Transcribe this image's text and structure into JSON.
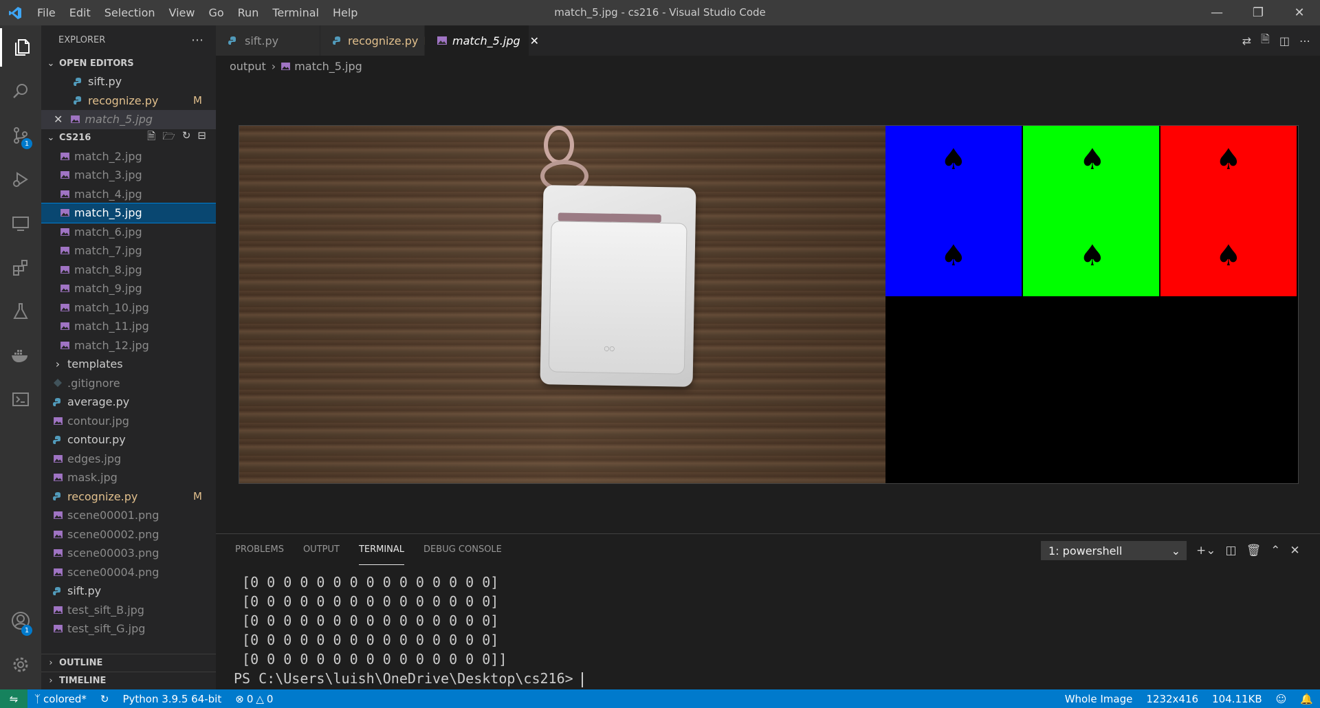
{
  "titlebar": {
    "menu": [
      "File",
      "Edit",
      "Selection",
      "View",
      "Go",
      "Run",
      "Terminal",
      "Help"
    ],
    "title": "match_5.jpg - cs216 - Visual Studio Code"
  },
  "activity": {
    "scm_badge": "1",
    "account_badge": "1"
  },
  "sidebar": {
    "header": "EXPLORER",
    "open_editors_label": "OPEN EDITORS",
    "open_editors": [
      {
        "name": "sift.py",
        "kind": "py",
        "modified": ""
      },
      {
        "name": "recognize.py",
        "kind": "py",
        "modified": "M"
      },
      {
        "name": "match_5.jpg",
        "kind": "img",
        "modified": ""
      }
    ],
    "folder_label": "CS216",
    "files": [
      {
        "name": "match_2.jpg",
        "kind": "img"
      },
      {
        "name": "match_3.jpg",
        "kind": "img"
      },
      {
        "name": "match_4.jpg",
        "kind": "img"
      },
      {
        "name": "match_5.jpg",
        "kind": "img"
      },
      {
        "name": "match_6.jpg",
        "kind": "img"
      },
      {
        "name": "match_7.jpg",
        "kind": "img"
      },
      {
        "name": "match_8.jpg",
        "kind": "img"
      },
      {
        "name": "match_9.jpg",
        "kind": "img"
      },
      {
        "name": "match_10.jpg",
        "kind": "img"
      },
      {
        "name": "match_11.jpg",
        "kind": "img"
      },
      {
        "name": "match_12.jpg",
        "kind": "img"
      }
    ],
    "root_items": [
      {
        "name": "templates",
        "kind": "folder"
      },
      {
        "name": ".gitignore",
        "kind": "git"
      },
      {
        "name": "average.py",
        "kind": "py"
      },
      {
        "name": "contour.jpg",
        "kind": "img"
      },
      {
        "name": "contour.py",
        "kind": "py"
      },
      {
        "name": "edges.jpg",
        "kind": "img"
      },
      {
        "name": "mask.jpg",
        "kind": "img"
      },
      {
        "name": "recognize.py",
        "kind": "py",
        "modified": "M"
      },
      {
        "name": "scene00001.png",
        "kind": "img"
      },
      {
        "name": "scene00002.png",
        "kind": "img"
      },
      {
        "name": "scene00003.png",
        "kind": "img"
      },
      {
        "name": "scene00004.png",
        "kind": "img"
      },
      {
        "name": "sift.py",
        "kind": "py"
      },
      {
        "name": "test_sift_B.jpg",
        "kind": "img"
      },
      {
        "name": "test_sift_G.jpg",
        "kind": "img"
      }
    ],
    "outline_label": "OUTLINE",
    "timeline_label": "TIMELINE"
  },
  "tabs": [
    {
      "name": "sift.py",
      "kind": "py",
      "modified": ""
    },
    {
      "name": "recognize.py",
      "kind": "py",
      "modified": "M"
    },
    {
      "name": "match_5.jpg",
      "kind": "img",
      "modified": ""
    }
  ],
  "breadcrumb": {
    "folder": "output",
    "file": "match_5.jpg"
  },
  "panel": {
    "tabs": [
      "PROBLEMS",
      "OUTPUT",
      "TERMINAL",
      "DEBUG CONSOLE"
    ],
    "active_tab": "TERMINAL",
    "terminal_select": "1: powershell",
    "terminal_lines": [
      " [0 0 0 0 0 0 0 0 0 0 0 0 0 0 0]",
      " [0 0 0 0 0 0 0 0 0 0 0 0 0 0 0]",
      " [0 0 0 0 0 0 0 0 0 0 0 0 0 0 0]",
      " [0 0 0 0 0 0 0 0 0 0 0 0 0 0 0]",
      " [0 0 0 0 0 0 0 0 0 0 0 0 0 0 0]]"
    ],
    "prompt": "PS C:\\Users\\luish\\OneDrive\\Desktop\\cs216> "
  },
  "statusbar": {
    "branch": "colored*",
    "python": "Python 3.9.5 64-bit",
    "errors": "0",
    "warnings": "0",
    "zoom": "Whole Image",
    "dimensions": "1232x416",
    "size": "104.11KB"
  },
  "colors": {
    "accent": "#007acc",
    "modified": "#e2c08d",
    "selection": "#094771",
    "py_icon": "#519aba",
    "img_icon": "#a074c4"
  }
}
